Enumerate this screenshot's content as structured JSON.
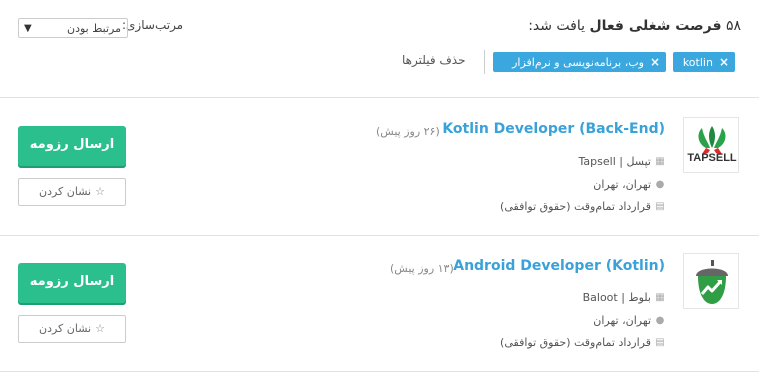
{
  "header": {
    "results_count": "۵۸",
    "results_bold": "فرصت شغلی فعال",
    "results_tail": "یافت شد:",
    "sort_label": "مرتب‌سازی:",
    "sort_value": "مرتبط بودن",
    "filters": [
      {
        "label": "kotlin",
        "remove": "×"
      },
      {
        "label": "وب، برنامه‌نویسی و نرم‌افزار",
        "remove": "×"
      }
    ],
    "clear_filters": "حذف فیلترها"
  },
  "jobs": [
    {
      "title": "Kotlin Developer (Back-End)",
      "ago": "(۲۶ روز پیش)",
      "company": "تپسل | Tapsell",
      "location": "تهران، تهران",
      "contract": "قرارداد تمام‌وقت (حقوق توافقی)",
      "logo_text": "TAPSELL",
      "apply": "ارسال رزومه",
      "bookmark": "نشان کردن"
    },
    {
      "title": "Android Developer (Kotlin)",
      "ago": "(۱۳ روز پیش)",
      "company": "بلوط | Baloot",
      "location": "تهران، تهران",
      "contract": "قرارداد تمام‌وقت (حقوق توافقی)",
      "apply": "ارسال رزومه",
      "bookmark": "نشان کردن"
    }
  ],
  "colors": {
    "accent_blue": "#3aa8de",
    "title_blue": "#3aa2d8",
    "apply_green": "#2bbf8e"
  }
}
